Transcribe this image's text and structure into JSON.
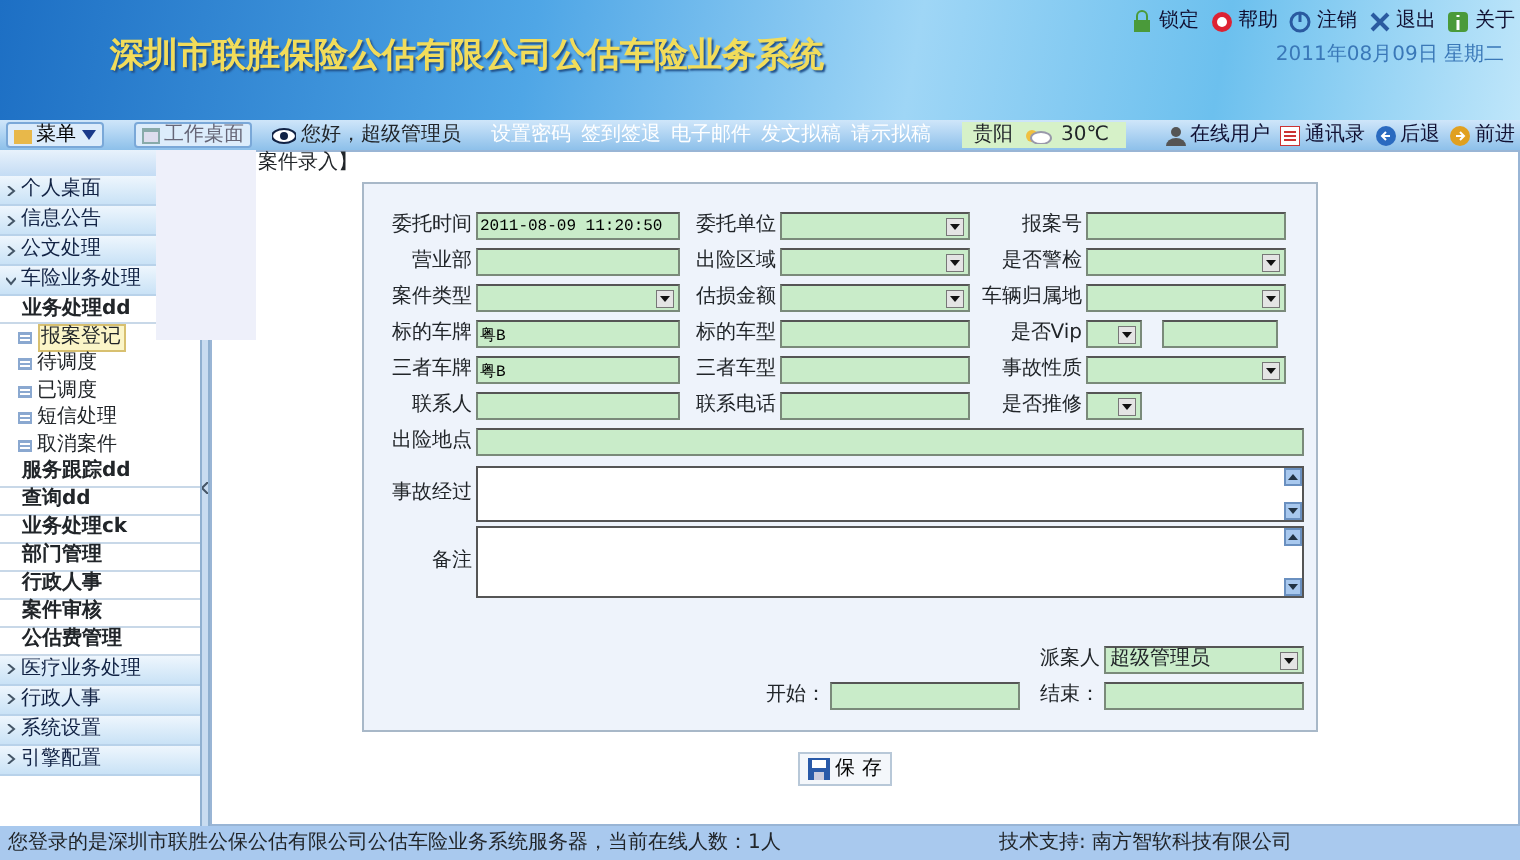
{
  "header": {
    "title": "深圳市联胜保险公估有限公司公估车险业务系统",
    "top_links": [
      "锁定",
      "帮助",
      "注销",
      "退出",
      "关于"
    ],
    "date": "2011年08月09日 星期二"
  },
  "nav": {
    "menu_button": "菜单",
    "desk_button": "工作桌面",
    "greeting": "您好，超级管理员",
    "links": [
      "设置密码",
      "签到签退",
      "电子邮件",
      "发文拟稿",
      "请示拟稿"
    ],
    "weather": {
      "city": "贵阳",
      "temperature": "30℃"
    },
    "right_links": [
      "在线用户",
      "通讯录",
      "后退",
      "前进"
    ]
  },
  "sidebar": {
    "items": [
      {
        "label": "个人桌面",
        "expanded": false
      },
      {
        "label": "信息公告",
        "expanded": false
      },
      {
        "label": "公文处理",
        "expanded": false
      },
      {
        "label": "车险业务处理",
        "expanded": true,
        "children": [
          {
            "label": "业务处理dd",
            "children": [
              {
                "label": "报案登记",
                "selected": true
              },
              {
                "label": "待调度",
                "selected": false
              },
              {
                "label": "已调度",
                "selected": false
              },
              {
                "label": "短信处理",
                "selected": false
              },
              {
                "label": "取消案件",
                "selected": false
              }
            ]
          },
          {
            "label": "服务跟踪dd"
          },
          {
            "label": "查询dd"
          },
          {
            "label": "业务处理ck"
          },
          {
            "label": "部门管理"
          },
          {
            "label": "行政人事"
          },
          {
            "label": "案件审核"
          },
          {
            "label": "公估费管理"
          }
        ]
      },
      {
        "label": "医疗业务处理",
        "expanded": false
      },
      {
        "label": "行政人事",
        "expanded": false
      },
      {
        "label": "系统设置",
        "expanded": false
      },
      {
        "label": "引擎配置",
        "expanded": false
      }
    ]
  },
  "tab": {
    "label": "案件录入】"
  },
  "form": {
    "rows": [
      [
        {
          "label": "委托时间",
          "kind": "text",
          "value": "2011-08-09 11:20:50"
        },
        {
          "label": "委托单位",
          "kind": "select"
        },
        {
          "label": "报案号",
          "kind": "text"
        }
      ],
      [
        {
          "label": "营业部",
          "kind": "text"
        },
        {
          "label": "出险区域",
          "kind": "select"
        },
        {
          "label": "是否警检",
          "kind": "select"
        }
      ],
      [
        {
          "label": "案件类型",
          "kind": "select"
        },
        {
          "label": "估损金额",
          "kind": "select"
        },
        {
          "label": "车辆归属地",
          "kind": "select"
        }
      ],
      [
        {
          "label": "标的车牌",
          "kind": "text",
          "value": "粤B"
        },
        {
          "label": "标的车型",
          "kind": "text"
        },
        {
          "label": "是否Vip",
          "kind": "select_text"
        }
      ],
      [
        {
          "label": "三者车牌",
          "kind": "text",
          "value": "粤B"
        },
        {
          "label": "三者车型",
          "kind": "text"
        },
        {
          "label": "事故性质",
          "kind": "select"
        }
      ],
      [
        {
          "label": "联系人",
          "kind": "text"
        },
        {
          "label": "联系电话",
          "kind": "text"
        },
        {
          "label": "是否推修",
          "kind": "small_select"
        }
      ]
    ],
    "location": {
      "label": "出险地点"
    },
    "textareas": [
      {
        "label": "事故经过"
      },
      {
        "label": "备注"
      }
    ],
    "dispatcher": {
      "label": "派案人",
      "value": "超级管理员"
    },
    "start": {
      "label": "开始："
    },
    "end": {
      "label": "结束："
    }
  },
  "save_button": "保 存",
  "status_bar": {
    "left": "您登录的是深圳市联胜公保公估有限公司公估车险业务系统服务器，当前在线人数：1人",
    "right": "技术支持: 南方智软科技有限公司"
  }
}
